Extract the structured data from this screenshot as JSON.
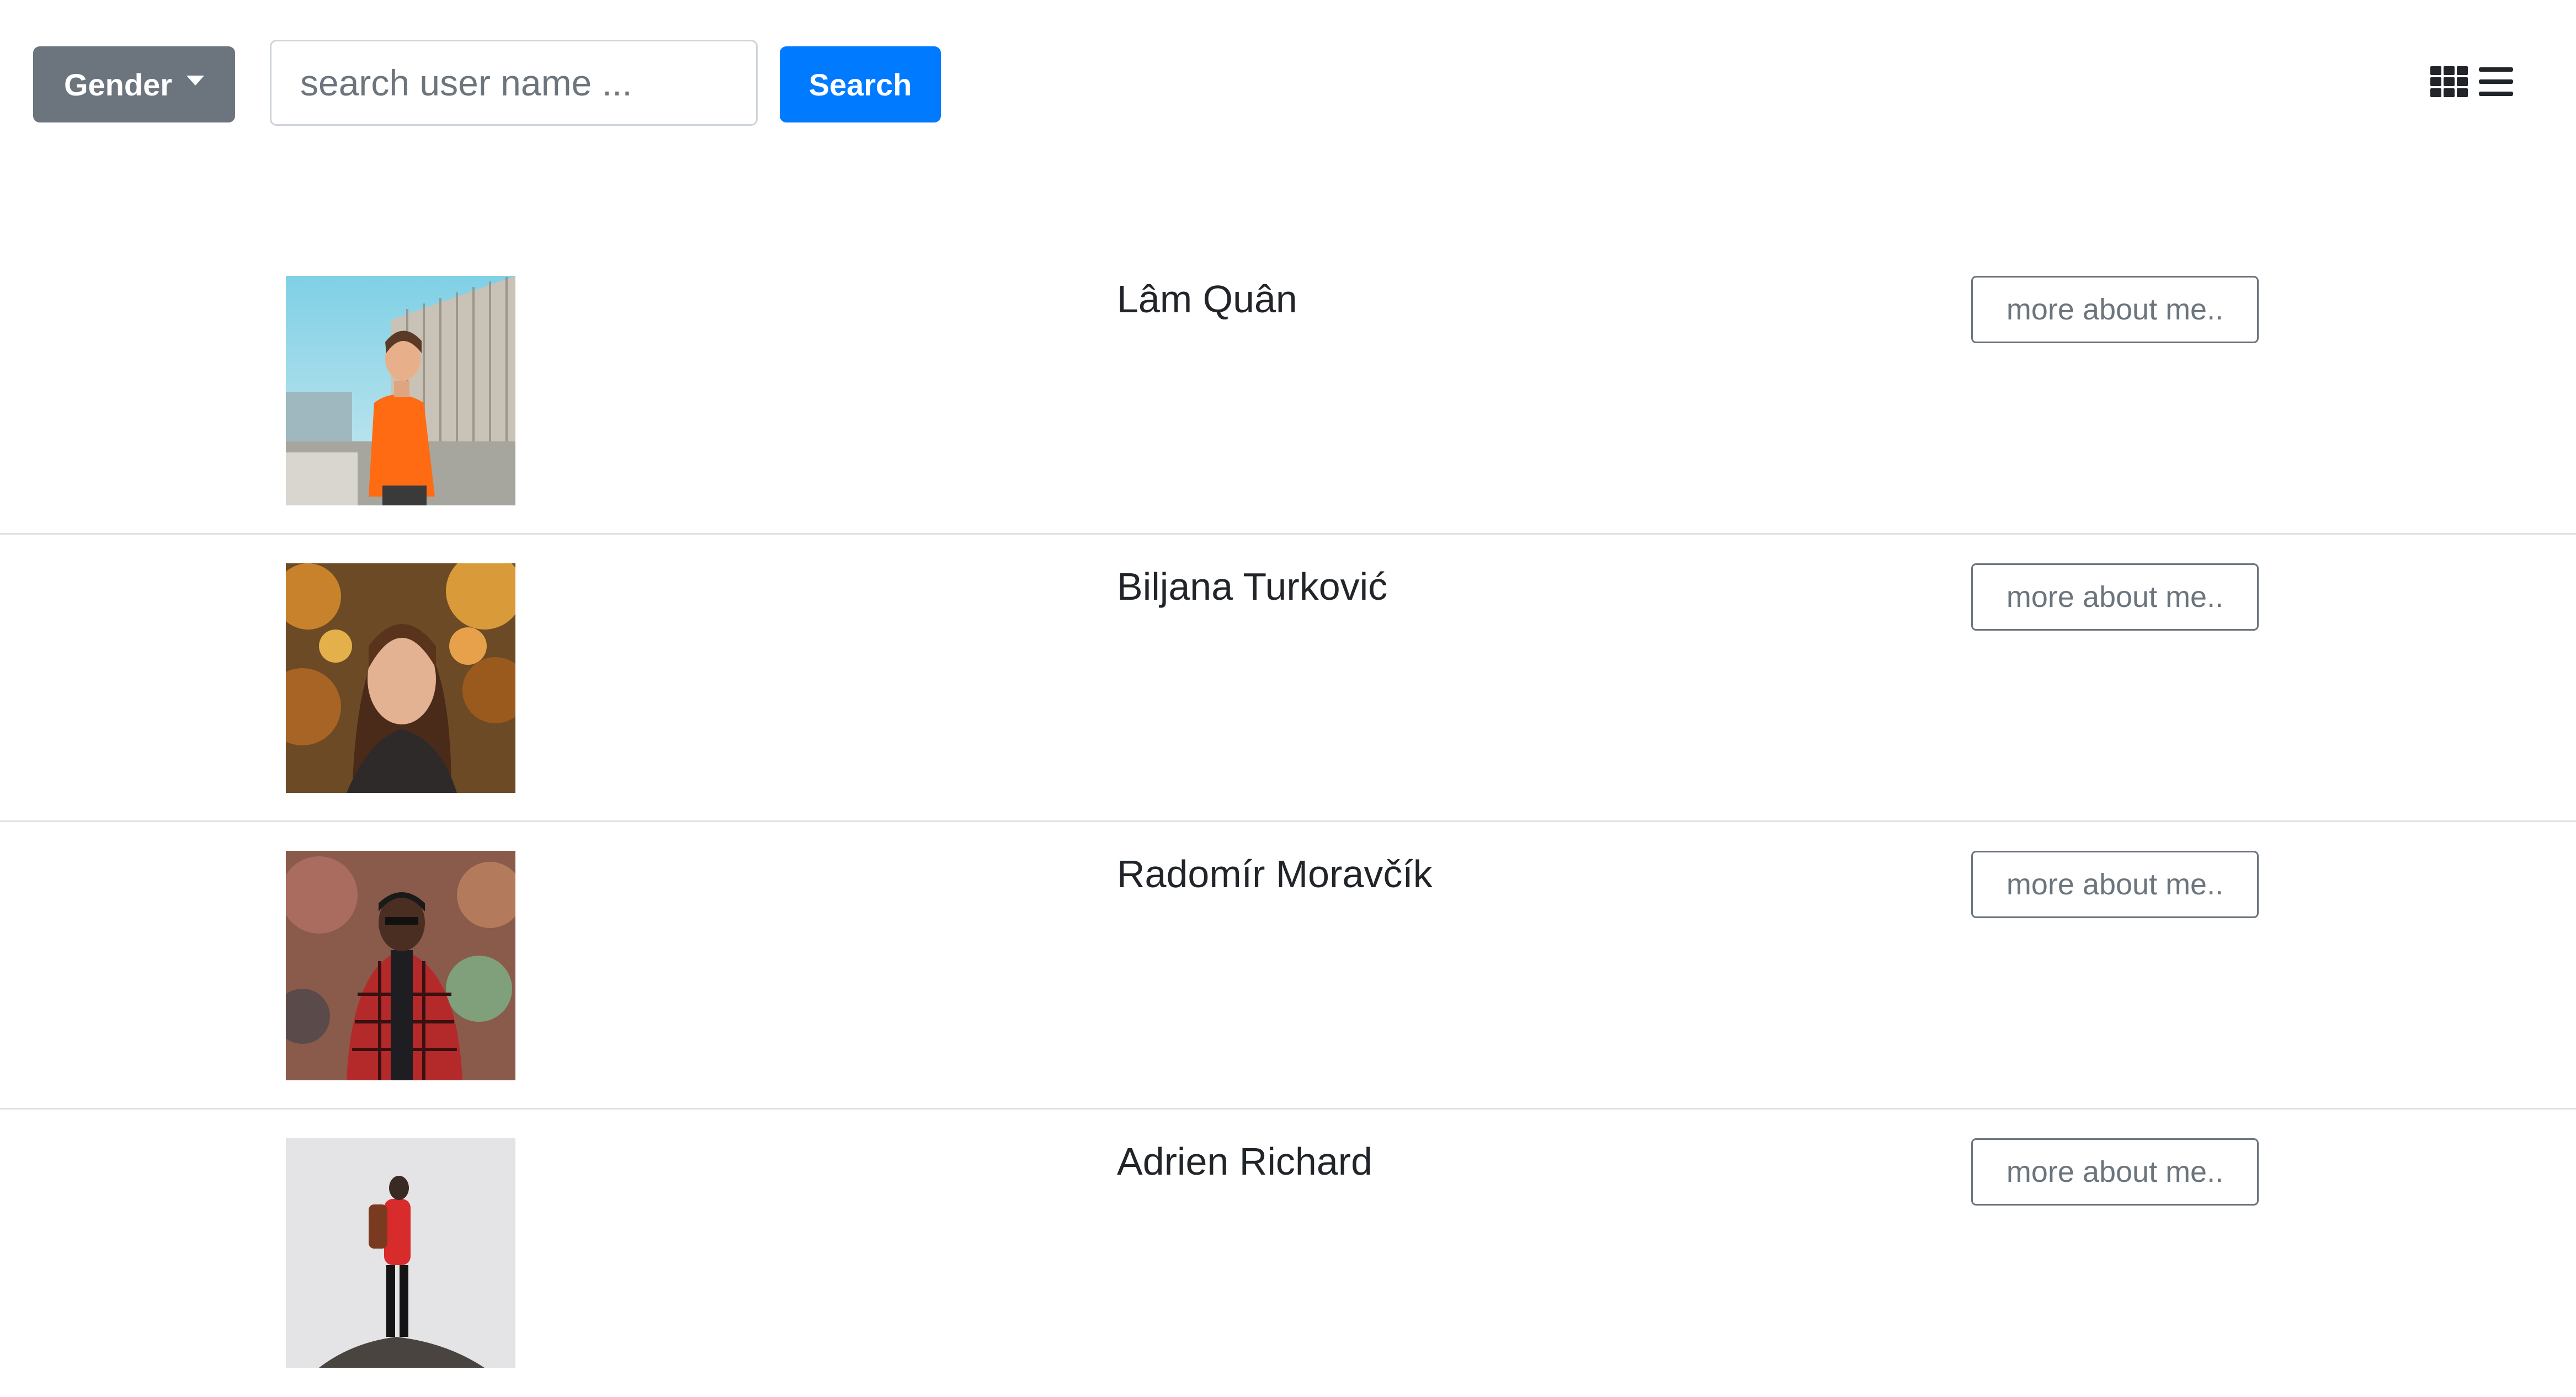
{
  "toolbar": {
    "gender_label": "Gender",
    "search_placeholder": "search user name ...",
    "search_label": "Search",
    "view_icons": [
      "grid-icon",
      "list-icon"
    ]
  },
  "users": [
    {
      "name": "Lâm Quân",
      "button_label": "more about me.."
    },
    {
      "name": "Biljana Turković",
      "button_label": "more about me.."
    },
    {
      "name": "Radomír Moravčík",
      "button_label": "more about me.."
    },
    {
      "name": "Adrien Richard",
      "button_label": "more about me.."
    }
  ],
  "colors": {
    "secondary": "#6c757d",
    "primary": "#007bff",
    "divider": "#dee2e6"
  }
}
